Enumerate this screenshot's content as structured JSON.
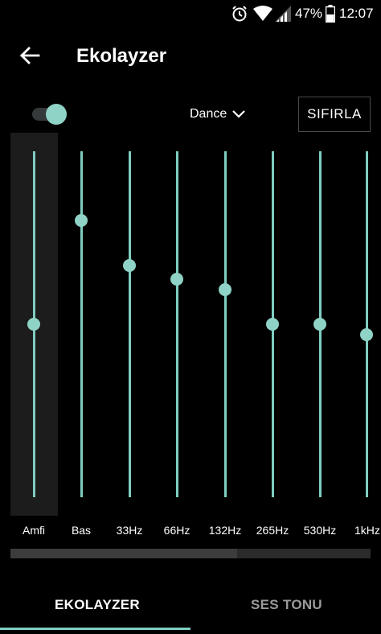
{
  "status_bar": {
    "battery_percent": "47%",
    "time": "12:07",
    "icons": [
      "alarm-icon",
      "wifi-icon",
      "signal-icon",
      "battery-icon"
    ]
  },
  "header": {
    "back_icon": "arrow-left-icon",
    "title": "Ekolayzer"
  },
  "controls": {
    "enabled": true,
    "preset": "Dance",
    "reset_label": "SIFIRLA"
  },
  "equalizer": {
    "bands": [
      {
        "label": "Amfi",
        "level": 0.5
      },
      {
        "label": "Bas",
        "level": 0.8
      },
      {
        "label": "33Hz",
        "level": 0.67
      },
      {
        "label": "66Hz",
        "level": 0.63
      },
      {
        "label": "132Hz",
        "level": 0.6
      },
      {
        "label": "265Hz",
        "level": 0.5
      },
      {
        "label": "530Hz",
        "level": 0.5
      },
      {
        "label": "1kHz",
        "level": 0.47
      }
    ],
    "scroll_position": 0.63
  },
  "tabs": [
    {
      "label": "EKOLAYZER",
      "active": true
    },
    {
      "label": "SES TONU",
      "active": false
    }
  ],
  "colors": {
    "accent": "#7ecdc0",
    "background": "#000000"
  }
}
